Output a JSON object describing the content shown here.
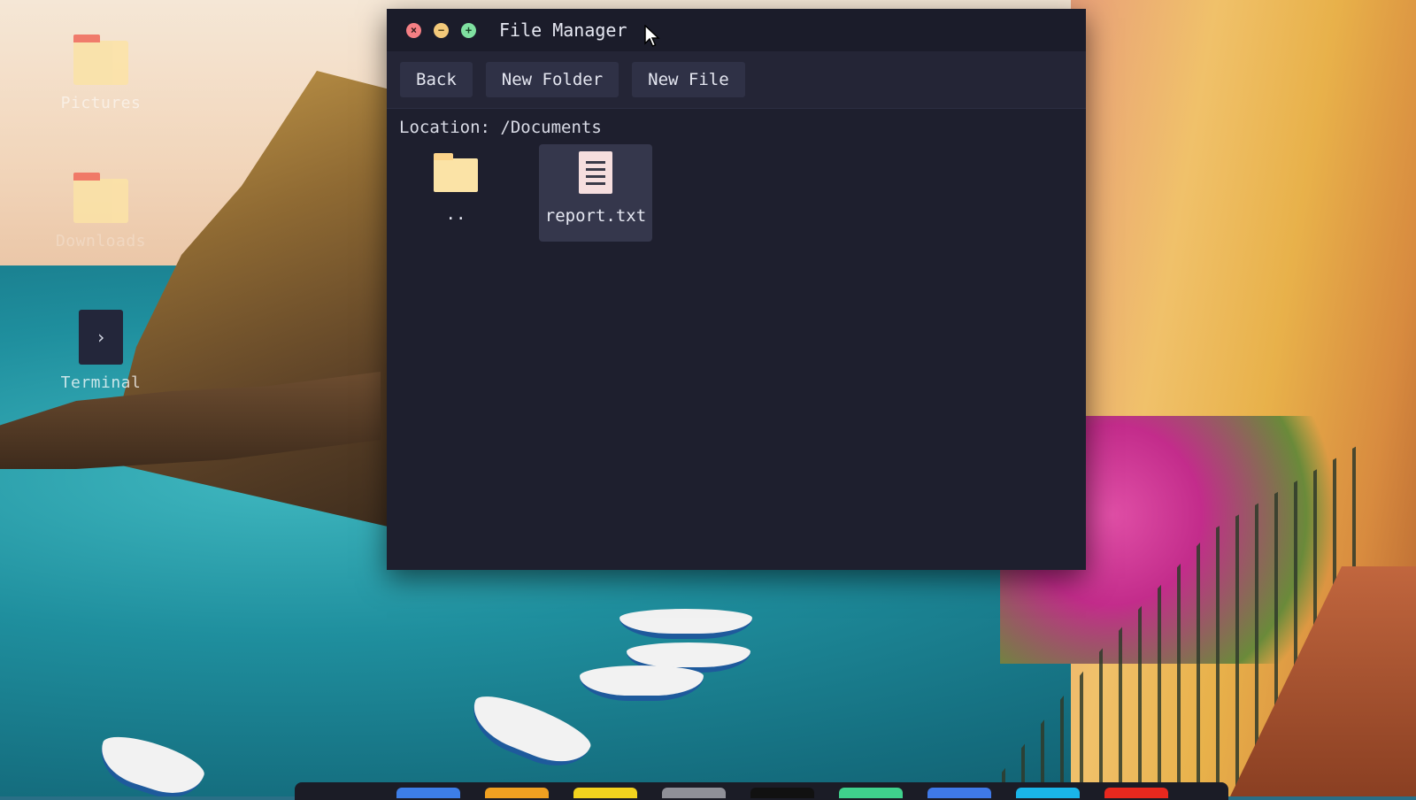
{
  "desktop": {
    "icons": [
      {
        "label": "Pictures",
        "icon": "folder-icon"
      },
      {
        "label": "Downloads",
        "icon": "folder-icon"
      },
      {
        "label": "Terminal",
        "icon": "terminal-icon",
        "glyph": "›"
      }
    ]
  },
  "window": {
    "title": "File Manager",
    "controls": {
      "close_glyph": "×",
      "minimize_glyph": "−",
      "maximize_glyph": "+"
    },
    "toolbar": {
      "back_label": "Back",
      "new_folder_label": "New Folder",
      "new_file_label": "New File"
    },
    "location": "Location: /Documents",
    "files": [
      {
        "name": "..",
        "type": "folder",
        "icon": "folder-icon",
        "selected": false
      },
      {
        "name": "report.txt",
        "type": "text",
        "icon": "text-file-icon",
        "selected": true
      }
    ]
  },
  "dock": {
    "apps": [
      {
        "name": "app-1",
        "color": "#3d7ee8"
      },
      {
        "name": "app-2",
        "color": "#f0a021"
      },
      {
        "name": "app-3",
        "color": "#f3d31e"
      },
      {
        "name": "app-4",
        "color": "#8f9098"
      },
      {
        "name": "app-5",
        "color": "#111111"
      },
      {
        "name": "app-6",
        "color": "#3fd18c"
      },
      {
        "name": "app-7",
        "color": "#3f79e8"
      },
      {
        "name": "app-8",
        "color": "#1ab5e8"
      },
      {
        "name": "app-9",
        "color": "#e8281e"
      }
    ]
  },
  "colors": {
    "window_bg": "#1e1f2e",
    "toolbar_bg": "#242536",
    "button_bg": "#2f3146",
    "selected_bg": "#35374c",
    "folder": "#fbe3a6",
    "folder_tab": "#f06a5a",
    "close": "#f57f84",
    "minimize": "#f3c97a",
    "maximize": "#7fe0a0"
  }
}
